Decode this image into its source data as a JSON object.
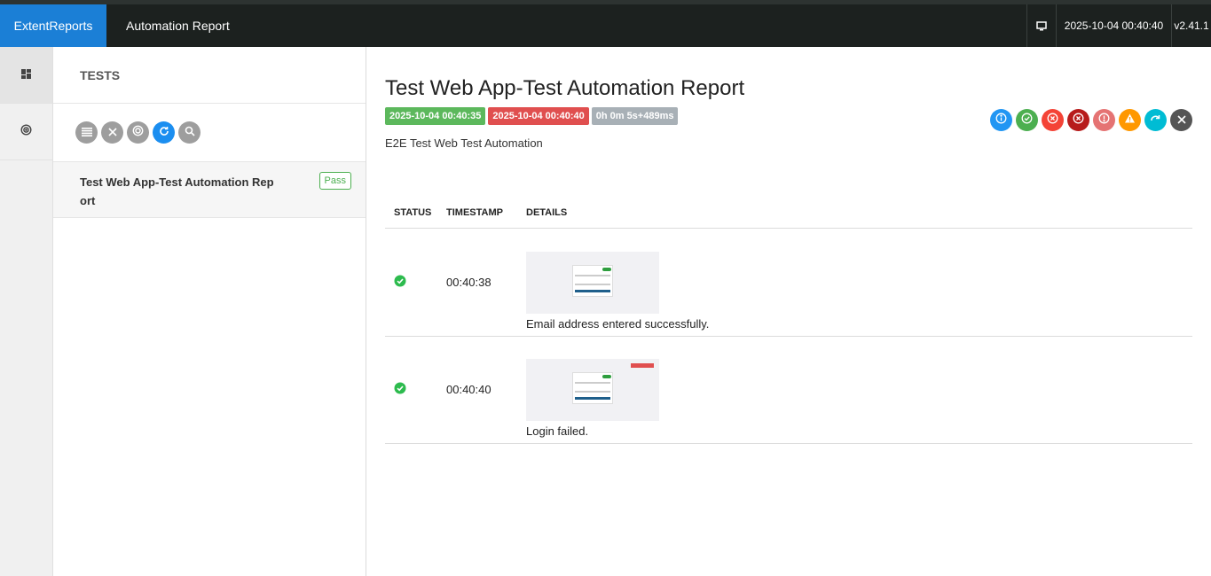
{
  "topbar": {
    "brand": "ExtentReports",
    "report_name": "Automation Report",
    "datetime": "2025-10-04 00:40:40",
    "version": "v2.41.1"
  },
  "sidebar": {
    "items": [
      {
        "name": "dashboard",
        "icon": "dashboard-icon"
      },
      {
        "name": "tests",
        "icon": "target-icon"
      }
    ]
  },
  "test_panel": {
    "heading": "TESTS",
    "filters": [
      "list-icon",
      "close-icon",
      "target-icon",
      "refresh-icon",
      "search-icon"
    ],
    "tests": [
      {
        "name": "Test Web App-Test Automation Report",
        "status": "Pass"
      }
    ]
  },
  "test_detail": {
    "title": "Test Web App-Test Automation Report",
    "start_time": "2025-10-04 00:40:35",
    "end_time": "2025-10-04 00:40:40",
    "duration": "0h 0m 5s+489ms",
    "description": "E2E Test Web Test Automation",
    "status_filters": [
      {
        "name": "info",
        "color": "#2196f3"
      },
      {
        "name": "pass",
        "color": "#4caf50"
      },
      {
        "name": "fail",
        "color": "#f44336"
      },
      {
        "name": "fatal",
        "color": "#b71c1c"
      },
      {
        "name": "error",
        "color": "#e57373"
      },
      {
        "name": "warning",
        "color": "#ff9800"
      },
      {
        "name": "skip",
        "color": "#00bcd4"
      },
      {
        "name": "clear",
        "color": "#555555"
      }
    ]
  },
  "log_table": {
    "headers": {
      "status": "STATUS",
      "timestamp": "TIMESTAMP",
      "details": "DETAILS"
    },
    "rows": [
      {
        "status": "pass",
        "timestamp": "00:40:38",
        "details": "Email address entered successfully."
      },
      {
        "status": "pass",
        "timestamp": "00:40:40",
        "details": "Login failed."
      }
    ]
  }
}
